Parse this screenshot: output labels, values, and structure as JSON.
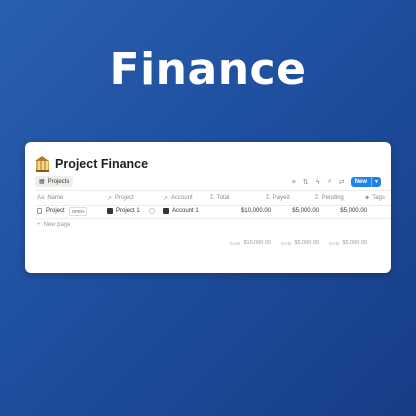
{
  "hero": {
    "title": "Finance"
  },
  "page": {
    "title": "Project Finance"
  },
  "view_tab": {
    "label": "Projects"
  },
  "toolbar": {
    "icons": [
      "filter-icon",
      "sort-icon",
      "lightning-icon",
      "search-icon",
      "more-icon"
    ],
    "new_label": "New"
  },
  "table": {
    "columns": [
      {
        "label": "Name",
        "icon": "text-icon"
      },
      {
        "label": "Project",
        "icon": "relation-icon"
      },
      {
        "label": "Account",
        "icon": "relation-icon"
      },
      {
        "label": "Total",
        "icon": "formula-icon"
      },
      {
        "label": "Payed",
        "icon": "formula-icon"
      },
      {
        "label": "Pending",
        "icon": "formula-icon"
      },
      {
        "label": "Tags",
        "icon": "tag-icon"
      }
    ],
    "rows": [
      {
        "name": "Project",
        "open_label": "OPEN",
        "project": "Project 1",
        "account": "Account 1",
        "total": "$10,000.00",
        "payed": "$5,000.00",
        "pending": "$5,000.00"
      }
    ],
    "new_page_label": "New page",
    "calculations": {
      "label": "SUM",
      "total": "$10,000.00",
      "payed": "$5,000.00",
      "pending": "$5,000.00"
    }
  },
  "colors": {
    "accent": "#2383e2",
    "background": "#1f4f9f"
  }
}
